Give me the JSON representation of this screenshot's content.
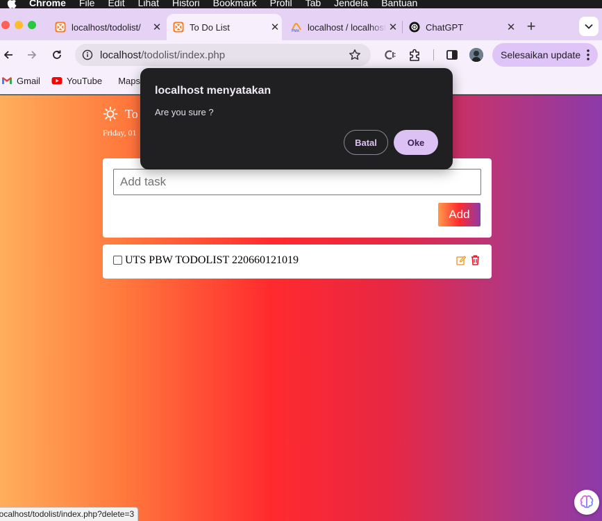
{
  "menubar": {
    "app": "Chrome",
    "items": [
      "File",
      "Edit",
      "Lihat",
      "Histori",
      "Bookmark",
      "Profil",
      "Tab",
      "Jendela",
      "Bantuan"
    ]
  },
  "tabs": [
    {
      "title": "localhost/todolist/",
      "active": false
    },
    {
      "title": "To Do List",
      "active": true
    },
    {
      "title": "localhost / localhost",
      "active": false
    },
    {
      "title": "ChatGPT",
      "active": false
    }
  ],
  "toolbar": {
    "url_host": "localhost",
    "url_path": "/todolist/index.php",
    "update_label": "Selesaikan update"
  },
  "bookmarks": [
    {
      "label": "Gmail",
      "icon": "gmail-icon"
    },
    {
      "label": "YouTube",
      "icon": "youtube-icon"
    },
    {
      "label": "Maps",
      "icon": "maps-icon"
    }
  ],
  "app": {
    "title": "To Do List",
    "date": "Friday, 01",
    "input_placeholder": "Add task",
    "add_label": "Add",
    "tasks": [
      {
        "text": "UTS PBW TODOLIST 220660121019",
        "done": false
      }
    ]
  },
  "dialog": {
    "title": "localhost menyatakan",
    "message": "Are you sure ?",
    "cancel_label": "Batal",
    "ok_label": "Oke"
  },
  "status_url": "localhost/todolist/index.php?delete=3",
  "colors": {
    "tabstrip": "#e6d2f5",
    "toolbar": "#f7f0fc",
    "dialog_bg": "#202023",
    "dialog_accent": "#dcc1f5",
    "delete_red": "#e0192a",
    "edit_orange": "#f0a033"
  }
}
